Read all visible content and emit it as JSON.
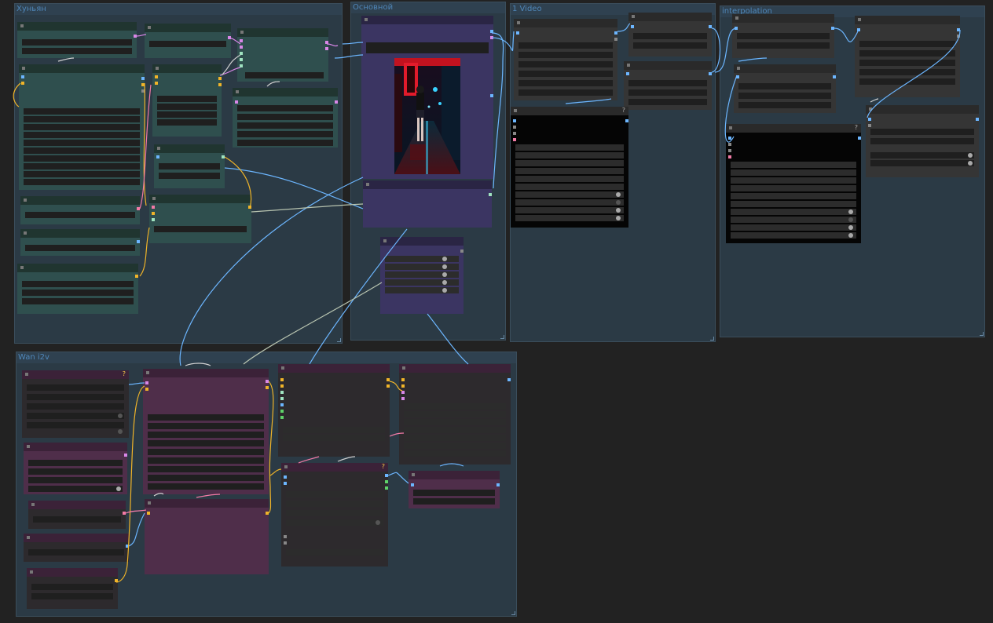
{
  "groups": {
    "hunyuan": "Хуньян",
    "main": "Основной",
    "video": "1 Video",
    "interpolation": "interpolation",
    "wan": "Wan i2v"
  },
  "colors": {
    "canvas": "#222222",
    "group_bg": "#2b3a45",
    "group_title": "#4f86b8",
    "node_teal": "#2f4f4e",
    "node_indigo": "#3b3562",
    "node_plum": "#4f2e4a",
    "node_dark": "#353535",
    "wire_blue": "#6cb6ff",
    "wire_yellow": "#f0b429",
    "wire_pink": "#f27aa6",
    "wire_gray": "#b8c4b0"
  },
  "icons": {
    "help": "?",
    "collapse": "node-collapse-icon"
  },
  "preview_image": "neon-alley-preview"
}
